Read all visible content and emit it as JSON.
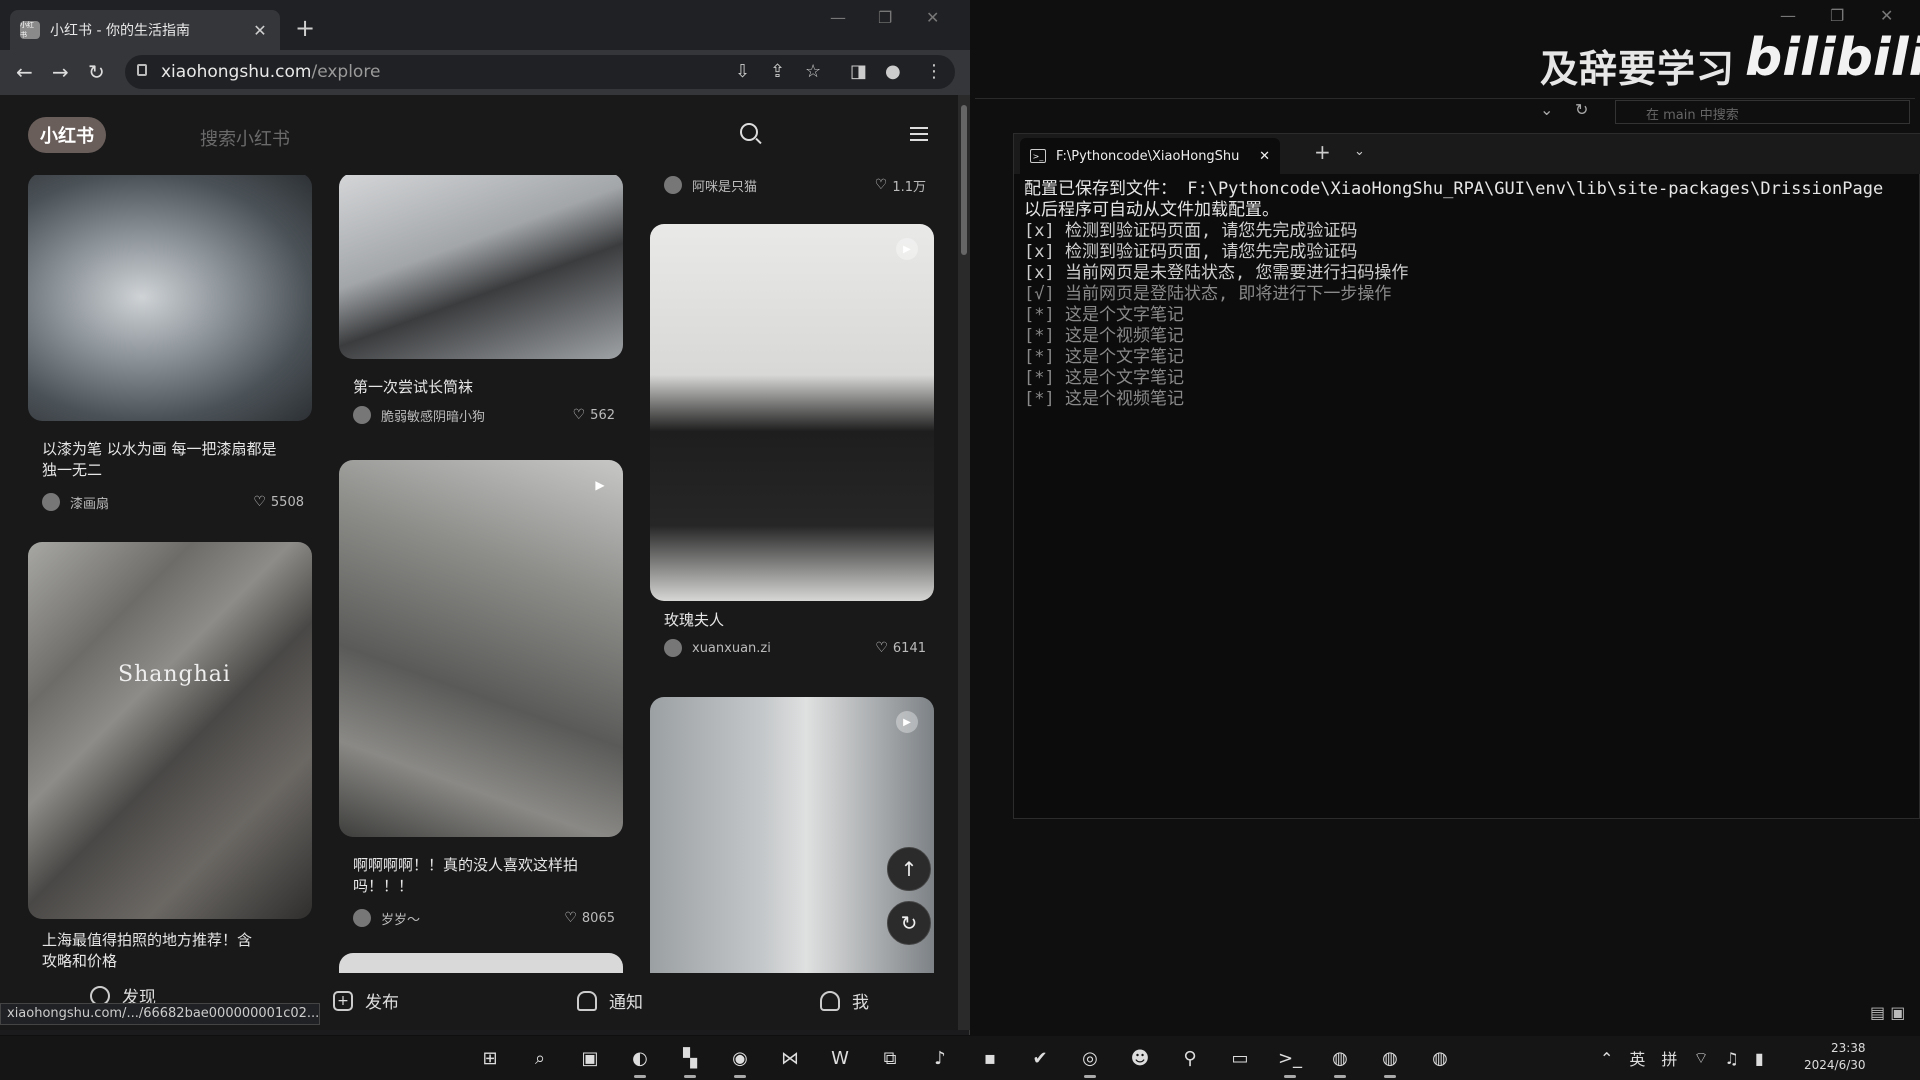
{
  "browser": {
    "tab_title": "小红书 - 你的生活指南",
    "favicon_text": "小红书",
    "url_host": "xiaohongshu.com",
    "url_path": "/explore",
    "status_url": "xiaohongshu.com/.../66682bae000000001c02..."
  },
  "xhs": {
    "logo": "小红书",
    "search_placeholder": "搜索小红书",
    "cards": [
      {
        "title_line1": "以漆为笔 以水为画 每一把漆扇都是",
        "title_line2": "独一无二",
        "author": "漆画扇",
        "likes": "5508"
      },
      {
        "title_line1": "",
        "title_line2": "",
        "author": "",
        "likes": ""
      },
      {
        "title_line1": "上海最值得拍照的地方推荐！含",
        "title_line2": "攻略和价格",
        "author": "",
        "likes": "",
        "img_text": "Shanghai"
      },
      {
        "title_line1": "第一次尝试长筒袜",
        "title_line2": "",
        "author": "脆弱敏感阴暗小狗",
        "likes": "562"
      },
      {
        "title_line1": "啊啊啊啊！！真的没人喜欢这样拍",
        "title_line2": "吗！！！",
        "author": "岁岁～",
        "likes": "8065"
      },
      {
        "title_line1": "",
        "title_line2": "",
        "author": "阿咪是只猫",
        "likes": "1.1万"
      },
      {
        "title_line1": "玫瑰夫人",
        "title_line2": "",
        "author": "xuanxuan.zi",
        "likes": "6141"
      }
    ],
    "bottom_nav": {
      "discover": "发现",
      "publish": "发布",
      "notify": "通知",
      "me": "我"
    }
  },
  "overlay": {
    "watermark": "及辞要学习",
    "bili_logo": "bilibili"
  },
  "explorer": {
    "search_placeholder": "在 main 中搜索"
  },
  "terminal": {
    "tab_title": "F:\\Pythoncode\\XiaoHongShu",
    "lines": [
      "配置已保存到文件： F:\\Pythoncode\\XiaoHongShu_RPA\\GUI\\env\\lib\\site-packages\\DrissionPage",
      "以后程序可自动从文件加载配置。",
      "[x] 检测到验证码页面, 请您先完成验证码",
      "[x] 检测到验证码页面, 请您先完成验证码",
      "[x] 当前网页是未登陆状态, 您需要进行扫码操作",
      "[√] 当前网页是登陆状态, 即将进行下一步操作",
      "[*] 这是个文字笔记",
      "[*] 这是个视频笔记",
      "[*] 这是个文字笔记",
      "[*] 这是个文字笔记",
      "[*] 这是个视频笔记"
    ],
    "line_colors": [
      "#e6e6e6",
      "#e6e6e6",
      "#cfcfcf",
      "#cfcfcf",
      "#cfcfcf",
      "#8a8a8a",
      "#8a8a8a",
      "#8a8a8a",
      "#8a8a8a",
      "#8a8a8a",
      "#8a8a8a"
    ]
  },
  "taskbar": {
    "ime_lang": "英",
    "ime_mode": "拼",
    "time": "23:38",
    "date": "2024/6/30"
  }
}
